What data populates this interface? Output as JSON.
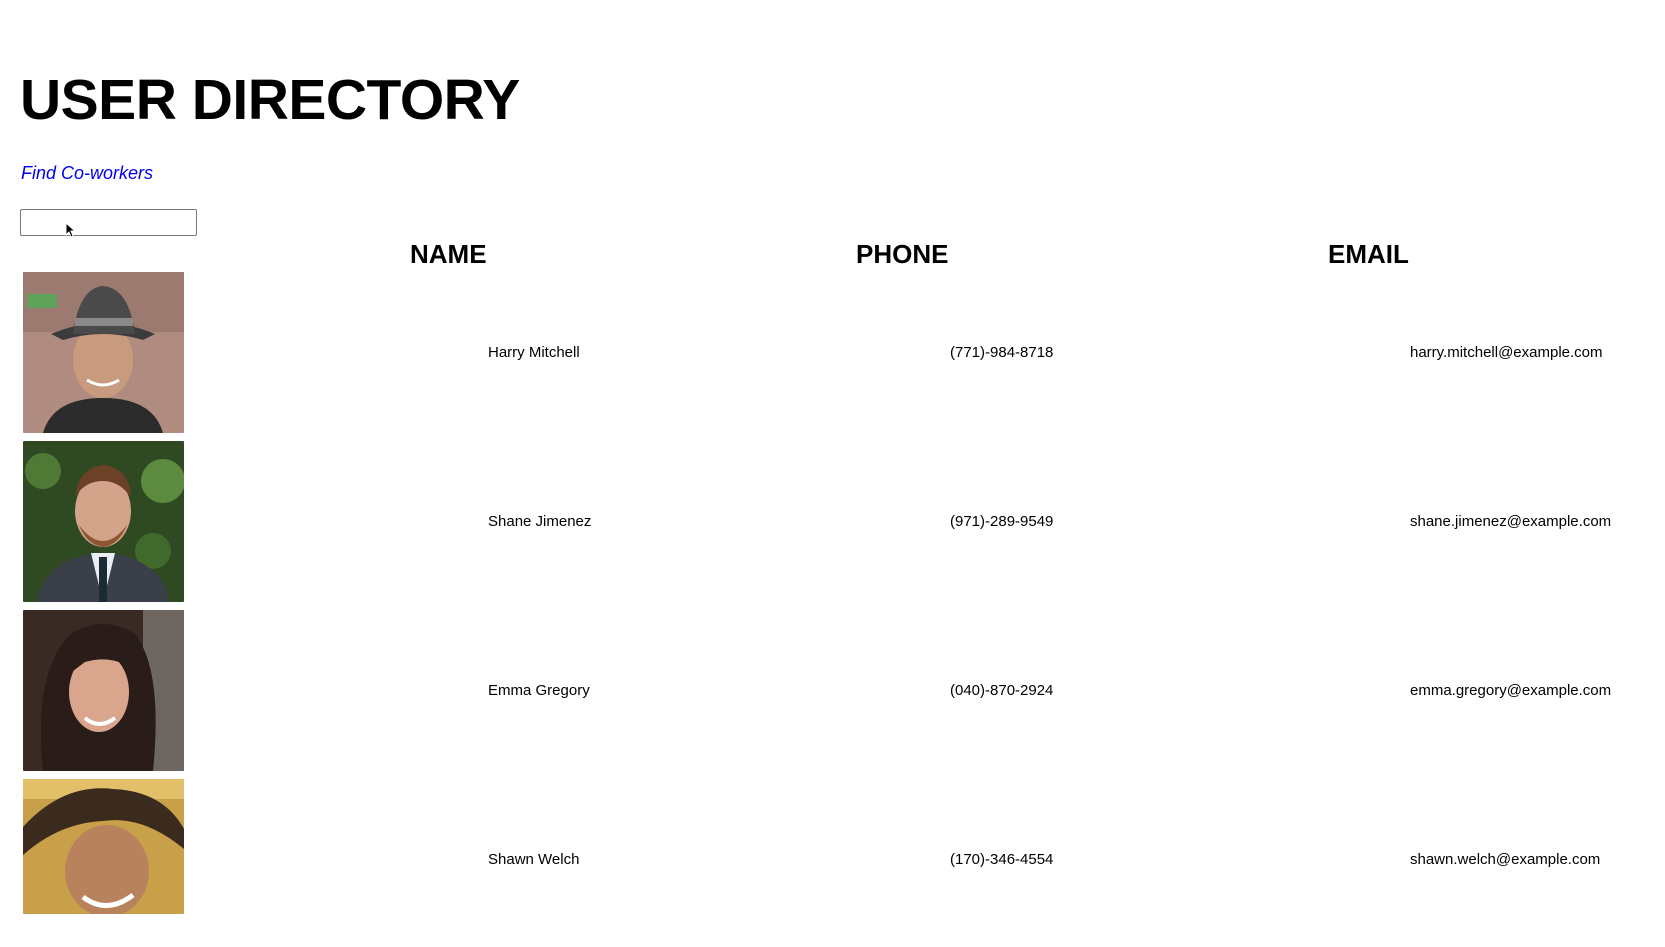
{
  "page": {
    "title": "USER DIRECTORY",
    "subtitle": "Find Co-workers"
  },
  "search": {
    "value": "",
    "placeholder": ""
  },
  "table": {
    "headers": [
      "NAME",
      "PHONE",
      "EMAIL"
    ],
    "rows": [
      {
        "name": "Harry Mitchell",
        "phone": "(771)-984-8718",
        "email": "harry.mitchell@example.com",
        "avatar_icon": "user-photo"
      },
      {
        "name": "Shane Jimenez",
        "phone": "(971)-289-9549",
        "email": "shane.jimenez@example.com",
        "avatar_icon": "user-photo"
      },
      {
        "name": "Emma Gregory",
        "phone": "(040)-870-2924",
        "email": "emma.gregory@example.com",
        "avatar_icon": "user-photo"
      },
      {
        "name": "Shawn Welch",
        "phone": "(170)-346-4554",
        "email": "shawn.welch@example.com",
        "avatar_icon": "user-photo"
      }
    ]
  },
  "colors": {
    "subtitle_link": "#0000ee",
    "text": "#000000",
    "background": "#ffffff"
  }
}
